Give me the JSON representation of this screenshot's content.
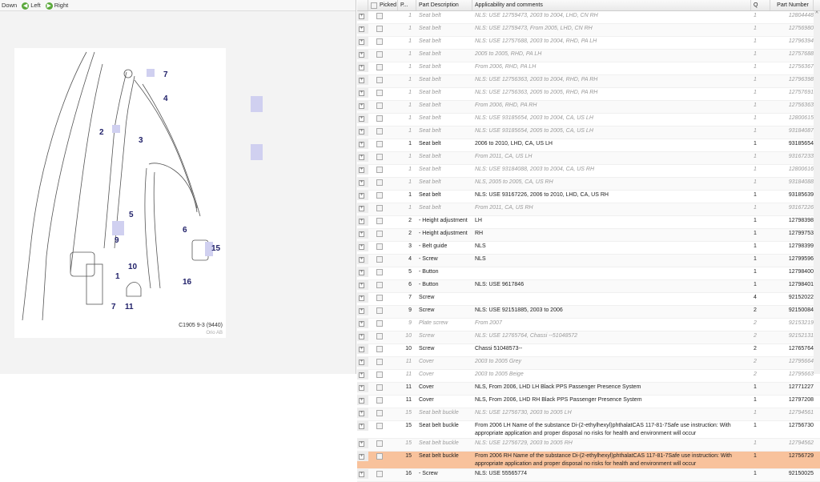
{
  "toolbar": {
    "down": "Down",
    "left": "Left",
    "right": "Right"
  },
  "diagram": {
    "caption": "C1905 9-3 (9440)",
    "copyright": "Orio AB",
    "callouts": [
      "7",
      "4",
      "2",
      "3",
      "5",
      "6",
      "9",
      "1",
      "10",
      "15",
      "16",
      "7",
      "11"
    ]
  },
  "table": {
    "headers": {
      "picked": "Picked",
      "pos": "P...",
      "desc": "Part Description",
      "appl": "Applicability and comments",
      "qty": "Q",
      "pn": "Part Number"
    },
    "rows": [
      {
        "p": "1",
        "d": "Seat belt",
        "a": "NLS: USE 12759473, 2003 to 2004, LHD, CN RH",
        "q": "1",
        "n": "12804448",
        "nls": true
      },
      {
        "p": "1",
        "d": "Seat belt",
        "a": "NLS: USE 12759473, From 2005, LHD, CN RH",
        "q": "1",
        "n": "12756980",
        "nls": true
      },
      {
        "p": "1",
        "d": "Seat belt",
        "a": "NLS: USE 12757688, 2003 to 2004, RHD, PA LH",
        "q": "1",
        "n": "12796394",
        "nls": true
      },
      {
        "p": "1",
        "d": "Seat belt",
        "a": "2005 to 2005, RHD, PA LH",
        "q": "1",
        "n": "12757688",
        "nls": true
      },
      {
        "p": "1",
        "d": "Seat belt",
        "a": "From 2006, RHD, PA LH",
        "q": "1",
        "n": "12756367",
        "nls": true
      },
      {
        "p": "1",
        "d": "Seat belt",
        "a": "NLS: USE 12756363, 2003 to 2004, RHD, PA RH",
        "q": "1",
        "n": "12796398",
        "nls": true
      },
      {
        "p": "1",
        "d": "Seat belt",
        "a": "NLS: USE 12756363, 2005 to 2005, RHD, PA RH",
        "q": "1",
        "n": "12757691",
        "nls": true
      },
      {
        "p": "1",
        "d": "Seat belt",
        "a": "From 2006, RHD, PA RH",
        "q": "1",
        "n": "12756363",
        "nls": true
      },
      {
        "p": "1",
        "d": "Seat belt",
        "a": "NLS: USE 93185654, 2003 to 2004, CA, US LH",
        "q": "1",
        "n": "12800615",
        "nls": true
      },
      {
        "p": "1",
        "d": "Seat belt",
        "a": "NLS: USE 93185654, 2005 to 2005, CA, US LH",
        "q": "1",
        "n": "93184087",
        "nls": true
      },
      {
        "p": "1",
        "d": "Seat belt",
        "a": "2006 to 2010, LHD, CA, US LH",
        "q": "1",
        "n": "93185654",
        "nls": false
      },
      {
        "p": "1",
        "d": "Seat belt",
        "a": "From 2011, CA, US LH",
        "q": "1",
        "n": "93167233",
        "nls": true
      },
      {
        "p": "1",
        "d": "Seat belt",
        "a": "NLS: USE 93184088, 2003 to 2004, CA, US RH",
        "q": "1",
        "n": "12800616",
        "nls": true
      },
      {
        "p": "1",
        "d": "Seat belt",
        "a": "NLS, 2005 to 2005, CA, US RH",
        "q": "1",
        "n": "93184088",
        "nls": true
      },
      {
        "p": "1",
        "d": "Seat belt",
        "a": "NLS: USE 93167226, 2006 to 2010, LHD, CA, US RH",
        "q": "1",
        "n": "93185639",
        "nls": false
      },
      {
        "p": "1",
        "d": "Seat belt",
        "a": "From 2011, CA, US RH",
        "q": "1",
        "n": "93167226",
        "nls": true
      },
      {
        "p": "2",
        "d": " - Height adjustment",
        "a": "LH",
        "q": "1",
        "n": "12798398",
        "nls": false
      },
      {
        "p": "2",
        "d": " - Height adjustment",
        "a": "RH",
        "q": "1",
        "n": "12799753",
        "nls": false
      },
      {
        "p": "3",
        "d": " - Belt guide",
        "a": "NLS",
        "q": "1",
        "n": "12798399",
        "nls": false
      },
      {
        "p": "4",
        "d": " - Screw",
        "a": "NLS",
        "q": "1",
        "n": "12799596",
        "nls": false
      },
      {
        "p": "5",
        "d": " - Button",
        "a": "",
        "q": "1",
        "n": "12798400",
        "nls": false
      },
      {
        "p": "6",
        "d": " - Button",
        "a": "NLS: USE 9617846",
        "q": "1",
        "n": "12798401",
        "nls": false
      },
      {
        "p": "7",
        "d": "Screw",
        "a": "",
        "q": "4",
        "n": "92152022",
        "nls": false
      },
      {
        "p": "9",
        "d": "Screw",
        "a": "NLS: USE 92151885, 2003 to 2006",
        "q": "2",
        "n": "92150084",
        "nls": false
      },
      {
        "p": "9",
        "d": "Plate screw",
        "a": "From 2007",
        "q": "2",
        "n": "92153219",
        "nls": true
      },
      {
        "p": "10",
        "d": "Screw",
        "a": "NLS: USE 12765764, Chassi --51048572",
        "q": "2",
        "n": "92152131",
        "nls": true
      },
      {
        "p": "10",
        "d": "Screw",
        "a": "Chassi 51048573--",
        "q": "2",
        "n": "12765764",
        "nls": false
      },
      {
        "p": "11",
        "d": "Cover",
        "a": "2003 to 2005 Grey",
        "q": "2",
        "n": "12795664",
        "nls": true
      },
      {
        "p": "11",
        "d": "Cover",
        "a": "2003 to 2005 Beige",
        "q": "2",
        "n": "12795663",
        "nls": true
      },
      {
        "p": "11",
        "d": "Cover",
        "a": "NLS, From 2006, LHD LH Black PPS Passenger Presence System",
        "q": "1",
        "n": "12771227",
        "nls": false
      },
      {
        "p": "11",
        "d": "Cover",
        "a": "NLS, From 2006, LHD RH Black PPS Passenger Presence System",
        "q": "1",
        "n": "12797208",
        "nls": false
      },
      {
        "p": "15",
        "d": "Seat belt buckle",
        "a": "NLS: USE 12756730, 2003 to 2005 LH",
        "q": "1",
        "n": "12794561",
        "nls": true
      },
      {
        "p": "15",
        "d": "Seat belt buckle",
        "a": "From 2006 LH\nName of the substance Di-(2-ethylhexyl)phthalatCAS 117-81-7Safe use instruction: With appropriate application and proper disposal no risks for health and environment will occur",
        "q": "1",
        "n": "12756730",
        "nls": false
      },
      {
        "p": "15",
        "d": "Seat belt buckle",
        "a": "NLS: USE 12756729, 2003 to 2005 RH",
        "q": "1",
        "n": "12794562",
        "nls": true
      },
      {
        "p": "15",
        "d": "Seat belt buckle",
        "a": "From 2006 RH\nName of the substance Di-(2-ethylhexyl)phthalatCAS 117-81-7Safe use instruction: With appropriate application and proper disposal no risks for health and environment will occur",
        "q": "1",
        "n": "12756729",
        "nls": false,
        "selected": true
      },
      {
        "p": "16",
        "d": " - Screw",
        "a": "NLS: USE 55565774",
        "q": "1",
        "n": "92150025",
        "nls": false
      }
    ]
  },
  "colors": {
    "selected_row": "#f8c29c",
    "callout_bg": "#d0d0f0"
  }
}
